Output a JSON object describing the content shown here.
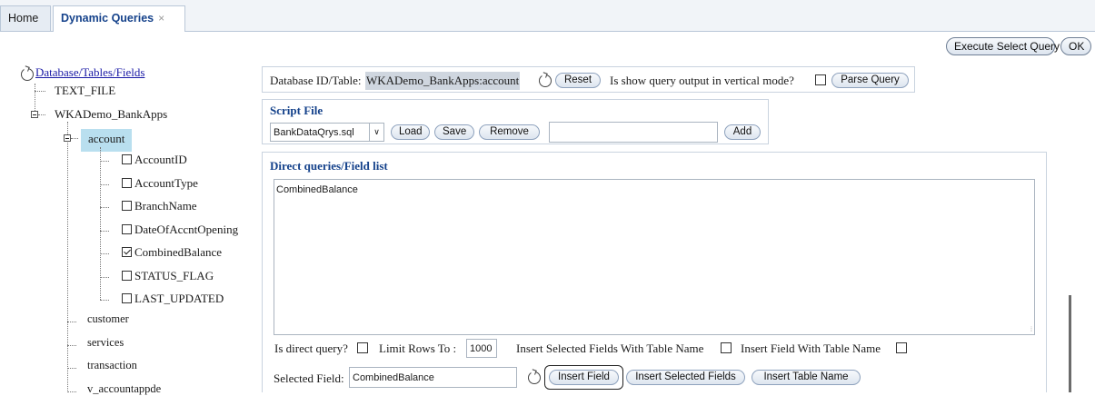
{
  "tabs": {
    "home": "Home",
    "active": "Dynamic Queries",
    "close": "×"
  },
  "toolbar": {
    "execute": "Execute Select Query",
    "ok": "OK"
  },
  "tree": {
    "root": "Database/Tables/Fields",
    "text_file": "TEXT_FILE",
    "db": "WKADemo_BankApps",
    "account": "account",
    "fields": [
      {
        "name": "AccountID",
        "checked": false
      },
      {
        "name": "AccountType",
        "checked": false
      },
      {
        "name": "BranchName",
        "checked": false
      },
      {
        "name": "DateOfAccntOpening",
        "checked": false
      },
      {
        "name": "CombinedBalance",
        "checked": true
      },
      {
        "name": "STATUS_FLAG",
        "checked": false
      },
      {
        "name": "LAST_UPDATED",
        "checked": false
      }
    ],
    "tables": [
      "customer",
      "services",
      "transaction",
      "v_accountappde"
    ]
  },
  "db_bar": {
    "label": "Database ID/Table:",
    "value": "WKADemo_BankApps:account",
    "reset": "Reset",
    "vertical_label": "Is show query output in vertical mode?",
    "parse": "Parse Query"
  },
  "script": {
    "title": "Script File",
    "selected_file": "BankDataQrys.sql",
    "load": "Load",
    "save": "Save",
    "remove": "Remove",
    "add": "Add"
  },
  "direct": {
    "title": "Direct queries/Field list",
    "text": "CombinedBalance",
    "is_direct": "Is direct query?",
    "limit_label": "Limit Rows To :",
    "limit_value": "1000",
    "insert_with_table": "Insert Selected Fields With Table Name",
    "insert_field_with_table": "Insert Field With Table Name",
    "selected_field_label": "Selected Field:",
    "selected_field_value": "CombinedBalance",
    "insert_field": "Insert Field",
    "insert_selected": "Insert Selected Fields",
    "insert_table": "Insert Table Name"
  }
}
